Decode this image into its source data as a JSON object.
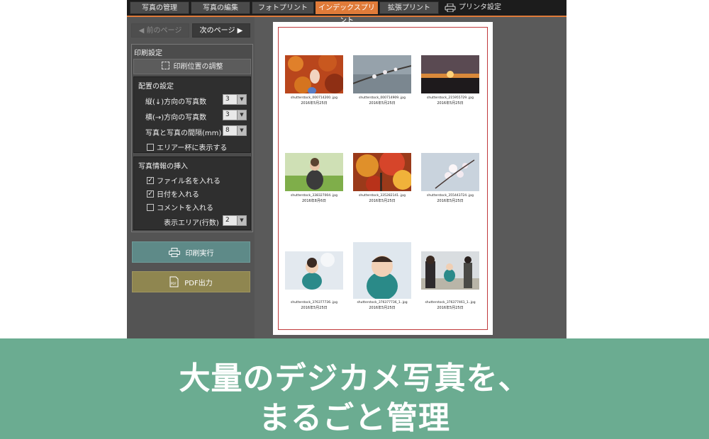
{
  "tabs": [
    {
      "label": "写真の管理",
      "active": false
    },
    {
      "label": "写真の編集",
      "active": false
    },
    {
      "label": "フォトプリント",
      "active": false
    },
    {
      "label": "インデックスプリント",
      "active": true
    },
    {
      "label": "拡張プリント",
      "active": false
    }
  ],
  "printer_settings_label": "プリンタ設定",
  "nav": {
    "prev": "◀ 前のページ",
    "next": "次のページ ▶"
  },
  "print_settings": {
    "title": "印刷設定",
    "adjust_label": "印刷位置の調整",
    "layout": {
      "title": "配置の設定",
      "vertical_label": "縦(↓)方向の写真数",
      "vertical_value": "3",
      "horizontal_label": "横(→)方向の写真数",
      "horizontal_value": "3",
      "spacing_label": "写真と写真の間隔(mm)",
      "spacing_value": "8",
      "fill_area_label": "エリアー杯に表示する",
      "fill_area_checked": false
    },
    "info": {
      "title": "写真情報の挿入",
      "filename_label": "ファイル名を入れる",
      "filename_checked": true,
      "date_label": "日付を入れる",
      "date_checked": true,
      "comment_label": "コメントを入れる",
      "comment_checked": false,
      "lines_label": "表示エリア(行数)",
      "lines_value": "2"
    }
  },
  "actions": {
    "print": "印刷実行",
    "pdf": "PDF出力"
  },
  "photos": [
    {
      "file": "shutterstock_000714200..jpg",
      "date": "2016年5月25日"
    },
    {
      "file": "shutterstock_000714909..jpg",
      "date": "2016年5月25日"
    },
    {
      "file": "shutterstock_215955729..jpg",
      "date": "2016年5月25日"
    },
    {
      "file": "shutterstock_338327004..jpg",
      "date": "2016年8月6日"
    },
    {
      "file": "shutterstock_335282141..jpg",
      "date": "2016年5月25日"
    },
    {
      "file": "shutterstock_355443724..jpg",
      "date": "2016年5月25日"
    },
    {
      "file": "shutterstock_376377736..jpg",
      "date": "2016年5月25日"
    },
    {
      "file": "shutterstock_376377736_1..jpg",
      "date": "2016年5月25日"
    },
    {
      "file": "shutterstock_376377461_1..jpg",
      "date": "2016年5月25日"
    }
  ],
  "banner": {
    "line1": "大量のデジカメ写真を、",
    "line2": "まるごと管理"
  }
}
